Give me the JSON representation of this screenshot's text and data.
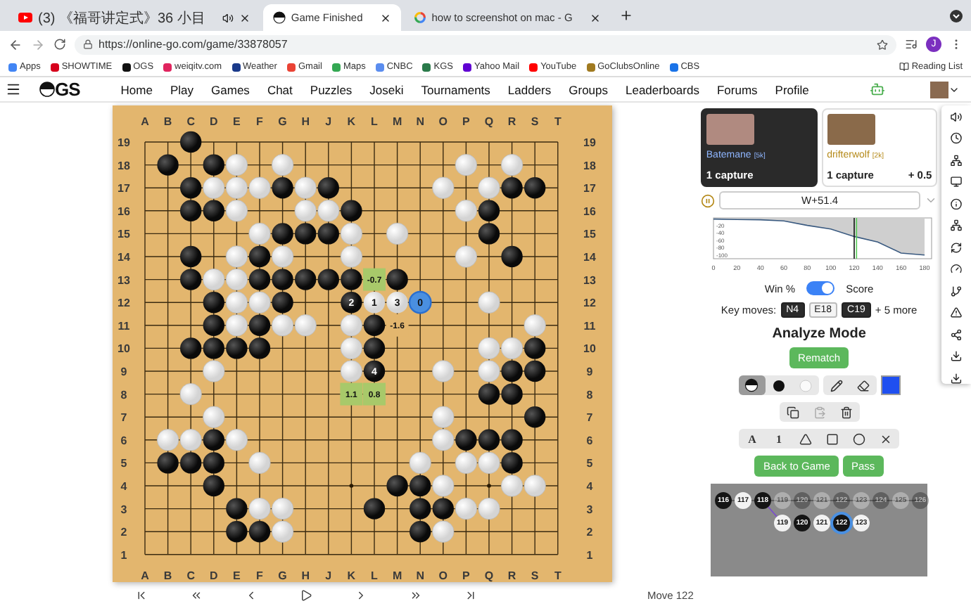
{
  "browser": {
    "tabs": [
      {
        "kind": "youtube",
        "title": "(3) 《福哥讲定式》36 小目",
        "audio": true,
        "selected": false
      },
      {
        "kind": "ogs",
        "title": "Game Finished",
        "audio": false,
        "selected": true
      },
      {
        "kind": "google",
        "title": "how to screenshot on mac - G",
        "audio": false,
        "selected": false
      }
    ],
    "url": "https://online-go.com/game/33878057",
    "profile": "J",
    "bookmarks": [
      {
        "label": "Apps",
        "color": "#4285f4"
      },
      {
        "label": "SHOWTIME",
        "color": "#d6001c"
      },
      {
        "label": "OGS",
        "color": "#111111"
      },
      {
        "label": "weiqitv.com",
        "color": "#e0245e"
      },
      {
        "label": "Weather",
        "color": "#1a3a8a"
      },
      {
        "label": "Gmail",
        "color": "#ea4335"
      },
      {
        "label": "Maps",
        "color": "#34a853"
      },
      {
        "label": "CNBC",
        "color": "#5b8def"
      },
      {
        "label": "KGS",
        "color": "#2a7a4a"
      },
      {
        "label": "Yahoo Mail",
        "color": "#6001d2"
      },
      {
        "label": "YouTube",
        "color": "#ff0000"
      },
      {
        "label": "GoClubsOnline",
        "color": "#a07a20"
      },
      {
        "label": "CBS",
        "color": "#1a73e8"
      }
    ],
    "reading_list": "Reading List"
  },
  "site_nav": {
    "logo": "GS",
    "links": [
      "Home",
      "Play",
      "Games",
      "Chat",
      "Puzzles",
      "Joseki",
      "Tournaments",
      "Ladders",
      "Groups",
      "Leaderboards",
      "Forums",
      "Profile"
    ]
  },
  "board": {
    "top_labels": [
      "A",
      "B",
      "C",
      "D",
      "E",
      "F",
      "G",
      "H",
      "J",
      "K",
      "L",
      "M",
      "N",
      "O",
      "P",
      "Q",
      "R",
      "S",
      "T"
    ],
    "bottom_labels": [
      "A",
      "B",
      "C",
      "D",
      "E",
      "F",
      "G",
      "H",
      "J",
      "K",
      "L",
      "M",
      "N",
      "O",
      "P",
      "Q",
      "R",
      "S",
      "T"
    ],
    "left_labels": [
      "19",
      "18",
      "17",
      "16",
      "15",
      "14",
      "13",
      "12",
      "11",
      "10",
      "9",
      "8",
      "7",
      "6",
      "5",
      "4",
      "3",
      "2",
      "1"
    ],
    "right_labels": [
      "19",
      "18",
      "17",
      "16",
      "15",
      "14",
      "13",
      "12",
      "11",
      "10",
      "9",
      "8",
      "7",
      "6",
      "5",
      "4",
      "3",
      "2",
      "1"
    ],
    "rows": [
      [
        {
          "kind": "empty"
        },
        {
          "kind": "empty"
        },
        {
          "kind": "black-stone"
        },
        {
          "kind": "empty"
        },
        {
          "kind": "empty"
        },
        {
          "kind": "empty"
        },
        {
          "kind": "empty"
        },
        {
          "kind": "empty"
        },
        {
          "kind": "empty"
        },
        {
          "kind": "empty"
        },
        {
          "kind": "empty"
        },
        {
          "kind": "empty"
        },
        {
          "kind": "empty"
        },
        {
          "kind": "empty"
        },
        {
          "kind": "empty"
        },
        {
          "kind": "empty"
        },
        {
          "kind": "empty"
        },
        {
          "kind": "empty"
        },
        {
          "kind": "empty"
        }
      ],
      [
        {
          "kind": "empty"
        },
        {
          "kind": "black-stone"
        },
        {
          "kind": "empty"
        },
        {
          "kind": "black-stone"
        },
        {
          "kind": "white-stone"
        },
        {
          "kind": "empty"
        },
        {
          "kind": "white-stone"
        },
        {
          "kind": "empty"
        },
        {
          "kind": "empty"
        },
        {
          "kind": "empty"
        },
        {
          "kind": "empty"
        },
        {
          "kind": "empty"
        },
        {
          "kind": "empty"
        },
        {
          "kind": "empty"
        },
        {
          "kind": "white-stone"
        },
        {
          "kind": "empty"
        },
        {
          "kind": "white-stone"
        },
        {
          "kind": "empty"
        },
        {
          "kind": "empty"
        }
      ],
      [
        {
          "kind": "empty"
        },
        {
          "kind": "empty"
        },
        {
          "kind": "black-stone"
        },
        {
          "kind": "white-stone"
        },
        {
          "kind": "white-stone"
        },
        {
          "kind": "white-stone"
        },
        {
          "kind": "black-stone"
        },
        {
          "kind": "white-stone"
        },
        {
          "kind": "black-stone"
        },
        {
          "kind": "empty"
        },
        {
          "kind": "empty"
        },
        {
          "kind": "empty"
        },
        {
          "kind": "empty"
        },
        {
          "kind": "white-stone"
        },
        {
          "kind": "empty"
        },
        {
          "kind": "white-stone"
        },
        {
          "kind": "black-stone"
        },
        {
          "kind": "black-stone"
        },
        {
          "kind": "empty"
        }
      ],
      [
        {
          "kind": "empty"
        },
        {
          "kind": "empty"
        },
        {
          "kind": "black-stone"
        },
        {
          "kind": "black-stone"
        },
        {
          "kind": "white-stone"
        },
        {
          "kind": "empty"
        },
        {
          "kind": "empty"
        },
        {
          "kind": "white-stone"
        },
        {
          "kind": "white-stone"
        },
        {
          "kind": "black-stone"
        },
        {
          "kind": "empty"
        },
        {
          "kind": "empty"
        },
        {
          "kind": "empty"
        },
        {
          "kind": "empty"
        },
        {
          "kind": "white-stone"
        },
        {
          "kind": "black-stone"
        },
        {
          "kind": "empty"
        },
        {
          "kind": "empty"
        },
        {
          "kind": "empty"
        }
      ],
      [
        {
          "kind": "empty"
        },
        {
          "kind": "empty"
        },
        {
          "kind": "empty"
        },
        {
          "kind": "empty"
        },
        {
          "kind": "empty"
        },
        {
          "kind": "white-stone"
        },
        {
          "kind": "black-stone"
        },
        {
          "kind": "black-stone"
        },
        {
          "kind": "black-stone"
        },
        {
          "kind": "white-stone"
        },
        {
          "kind": "empty"
        },
        {
          "kind": "white-stone"
        },
        {
          "kind": "empty"
        },
        {
          "kind": "empty"
        },
        {
          "kind": "empty"
        },
        {
          "kind": "black-stone"
        },
        {
          "kind": "empty"
        },
        {
          "kind": "empty"
        },
        {
          "kind": "empty"
        }
      ],
      [
        {
          "kind": "empty"
        },
        {
          "kind": "empty"
        },
        {
          "kind": "black-stone"
        },
        {
          "kind": "empty"
        },
        {
          "kind": "white-stone"
        },
        {
          "kind": "black-stone"
        },
        {
          "kind": "white-stone"
        },
        {
          "kind": "empty"
        },
        {
          "kind": "empty"
        },
        {
          "kind": "white-stone"
        },
        {
          "kind": "empty"
        },
        {
          "kind": "empty"
        },
        {
          "kind": "empty"
        },
        {
          "kind": "empty"
        },
        {
          "kind": "white-stone"
        },
        {
          "kind": "empty"
        },
        {
          "kind": "black-stone"
        },
        {
          "kind": "empty"
        },
        {
          "kind": "empty"
        }
      ],
      [
        {
          "kind": "empty"
        },
        {
          "kind": "empty"
        },
        {
          "kind": "black-stone"
        },
        {
          "kind": "white-stone"
        },
        {
          "kind": "white-stone"
        },
        {
          "kind": "black-stone"
        },
        {
          "kind": "black-stone"
        },
        {
          "kind": "black-stone"
        },
        {
          "kind": "black-stone"
        },
        {
          "kind": "black-stone"
        },
        {
          "kind": "score",
          "text": "-0.7",
          "highlighted": true
        },
        {
          "kind": "black-stone"
        },
        {
          "kind": "empty"
        },
        {
          "kind": "empty"
        },
        {
          "kind": "empty"
        },
        {
          "kind": "empty"
        },
        {
          "kind": "empty"
        },
        {
          "kind": "empty"
        },
        {
          "kind": "empty"
        }
      ],
      [
        {
          "kind": "empty"
        },
        {
          "kind": "empty"
        },
        {
          "kind": "empty"
        },
        {
          "kind": "black-stone"
        },
        {
          "kind": "white-stone"
        },
        {
          "kind": "white-stone"
        },
        {
          "kind": "black-stone"
        },
        {
          "kind": "empty"
        },
        {
          "kind": "empty"
        },
        {
          "kind": "numbered",
          "black": true,
          "candidate": false,
          "text": "2"
        },
        {
          "kind": "numbered",
          "black": false,
          "candidate": false,
          "text": "1"
        },
        {
          "kind": "numbered",
          "black": false,
          "candidate": false,
          "text": "3"
        },
        {
          "kind": "numbered",
          "black": false,
          "candidate": true,
          "text": "0"
        },
        {
          "kind": "empty"
        },
        {
          "kind": "empty"
        },
        {
          "kind": "white-stone"
        },
        {
          "kind": "empty"
        },
        {
          "kind": "empty"
        },
        {
          "kind": "empty"
        }
      ],
      [
        {
          "kind": "empty"
        },
        {
          "kind": "empty"
        },
        {
          "kind": "empty"
        },
        {
          "kind": "black-stone"
        },
        {
          "kind": "white-stone"
        },
        {
          "kind": "black-stone"
        },
        {
          "kind": "white-stone"
        },
        {
          "kind": "white-stone"
        },
        {
          "kind": "empty"
        },
        {
          "kind": "white-stone"
        },
        {
          "kind": "black-stone"
        },
        {
          "kind": "score",
          "text": "-1.6",
          "highlighted": false
        },
        {
          "kind": "empty"
        },
        {
          "kind": "empty"
        },
        {
          "kind": "empty"
        },
        {
          "kind": "empty"
        },
        {
          "kind": "empty"
        },
        {
          "kind": "white-stone"
        },
        {
          "kind": "empty"
        }
      ],
      [
        {
          "kind": "empty"
        },
        {
          "kind": "empty"
        },
        {
          "kind": "black-stone"
        },
        {
          "kind": "black-stone"
        },
        {
          "kind": "black-stone"
        },
        {
          "kind": "black-stone"
        },
        {
          "kind": "empty"
        },
        {
          "kind": "empty"
        },
        {
          "kind": "empty"
        },
        {
          "kind": "white-stone"
        },
        {
          "kind": "black-stone"
        },
        {
          "kind": "empty"
        },
        {
          "kind": "empty"
        },
        {
          "kind": "empty"
        },
        {
          "kind": "empty"
        },
        {
          "kind": "white-stone"
        },
        {
          "kind": "white-stone"
        },
        {
          "kind": "black-stone"
        },
        {
          "kind": "empty"
        }
      ],
      [
        {
          "kind": "empty"
        },
        {
          "kind": "empty"
        },
        {
          "kind": "empty"
        },
        {
          "kind": "white-stone"
        },
        {
          "kind": "empty"
        },
        {
          "kind": "empty"
        },
        {
          "kind": "empty"
        },
        {
          "kind": "empty"
        },
        {
          "kind": "empty"
        },
        {
          "kind": "white-stone"
        },
        {
          "kind": "numbered",
          "black": true,
          "candidate": false,
          "text": "4"
        },
        {
          "kind": "empty"
        },
        {
          "kind": "empty"
        },
        {
          "kind": "white-stone"
        },
        {
          "kind": "empty"
        },
        {
          "kind": "white-stone"
        },
        {
          "kind": "black-stone"
        },
        {
          "kind": "black-stone"
        },
        {
          "kind": "empty"
        }
      ],
      [
        {
          "kind": "empty"
        },
        {
          "kind": "empty"
        },
        {
          "kind": "white-stone"
        },
        {
          "kind": "empty"
        },
        {
          "kind": "empty"
        },
        {
          "kind": "empty"
        },
        {
          "kind": "empty"
        },
        {
          "kind": "empty"
        },
        {
          "kind": "empty"
        },
        {
          "kind": "score",
          "text": "1.1",
          "highlighted": true
        },
        {
          "kind": "score",
          "text": "0.8",
          "highlighted": true
        },
        {
          "kind": "empty"
        },
        {
          "kind": "empty"
        },
        {
          "kind": "empty"
        },
        {
          "kind": "empty"
        },
        {
          "kind": "black-stone"
        },
        {
          "kind": "black-stone"
        },
        {
          "kind": "empty"
        },
        {
          "kind": "empty"
        }
      ],
      [
        {
          "kind": "empty"
        },
        {
          "kind": "empty"
        },
        {
          "kind": "empty"
        },
        {
          "kind": "white-stone"
        },
        {
          "kind": "empty"
        },
        {
          "kind": "empty"
        },
        {
          "kind": "empty"
        },
        {
          "kind": "empty"
        },
        {
          "kind": "empty"
        },
        {
          "kind": "empty"
        },
        {
          "kind": "empty"
        },
        {
          "kind": "empty"
        },
        {
          "kind": "empty"
        },
        {
          "kind": "white-stone"
        },
        {
          "kind": "empty"
        },
        {
          "kind": "empty"
        },
        {
          "kind": "empty"
        },
        {
          "kind": "black-stone"
        },
        {
          "kind": "empty"
        }
      ],
      [
        {
          "kind": "empty"
        },
        {
          "kind": "white-stone"
        },
        {
          "kind": "white-stone"
        },
        {
          "kind": "black-stone"
        },
        {
          "kind": "white-stone"
        },
        {
          "kind": "empty"
        },
        {
          "kind": "empty"
        },
        {
          "kind": "empty"
        },
        {
          "kind": "empty"
        },
        {
          "kind": "empty"
        },
        {
          "kind": "empty"
        },
        {
          "kind": "empty"
        },
        {
          "kind": "empty"
        },
        {
          "kind": "white-stone"
        },
        {
          "kind": "black-stone"
        },
        {
          "kind": "black-stone"
        },
        {
          "kind": "black-stone"
        },
        {
          "kind": "empty"
        },
        {
          "kind": "empty"
        }
      ],
      [
        {
          "kind": "empty"
        },
        {
          "kind": "black-stone"
        },
        {
          "kind": "black-stone"
        },
        {
          "kind": "black-stone"
        },
        {
          "kind": "empty"
        },
        {
          "kind": "white-stone"
        },
        {
          "kind": "empty"
        },
        {
          "kind": "empty"
        },
        {
          "kind": "empty"
        },
        {
          "kind": "empty"
        },
        {
          "kind": "empty"
        },
        {
          "kind": "empty"
        },
        {
          "kind": "white-stone"
        },
        {
          "kind": "empty"
        },
        {
          "kind": "white-stone"
        },
        {
          "kind": "white-stone"
        },
        {
          "kind": "black-stone"
        },
        {
          "kind": "empty"
        },
        {
          "kind": "empty"
        }
      ],
      [
        {
          "kind": "empty"
        },
        {
          "kind": "empty"
        },
        {
          "kind": "empty"
        },
        {
          "kind": "black-stone"
        },
        {
          "kind": "empty"
        },
        {
          "kind": "empty"
        },
        {
          "kind": "empty"
        },
        {
          "kind": "empty"
        },
        {
          "kind": "empty"
        },
        {
          "kind": "empty"
        },
        {
          "kind": "empty"
        },
        {
          "kind": "black-stone"
        },
        {
          "kind": "black-stone"
        },
        {
          "kind": "white-stone"
        },
        {
          "kind": "empty"
        },
        {
          "kind": "empty"
        },
        {
          "kind": "white-stone"
        },
        {
          "kind": "white-stone"
        },
        {
          "kind": "empty"
        }
      ],
      [
        {
          "kind": "empty"
        },
        {
          "kind": "empty"
        },
        {
          "kind": "empty"
        },
        {
          "kind": "empty"
        },
        {
          "kind": "black-stone"
        },
        {
          "kind": "white-stone"
        },
        {
          "kind": "white-stone"
        },
        {
          "kind": "empty"
        },
        {
          "kind": "empty"
        },
        {
          "kind": "empty"
        },
        {
          "kind": "black-stone"
        },
        {
          "kind": "empty"
        },
        {
          "kind": "black-stone"
        },
        {
          "kind": "black-stone"
        },
        {
          "kind": "white-stone"
        },
        {
          "kind": "white-stone"
        },
        {
          "kind": "empty"
        },
        {
          "kind": "empty"
        },
        {
          "kind": "empty"
        }
      ],
      [
        {
          "kind": "empty"
        },
        {
          "kind": "empty"
        },
        {
          "kind": "empty"
        },
        {
          "kind": "empty"
        },
        {
          "kind": "black-stone"
        },
        {
          "kind": "black-stone"
        },
        {
          "kind": "white-stone"
        },
        {
          "kind": "empty"
        },
        {
          "kind": "empty"
        },
        {
          "kind": "empty"
        },
        {
          "kind": "empty"
        },
        {
          "kind": "empty"
        },
        {
          "kind": "black-stone"
        },
        {
          "kind": "white-stone"
        },
        {
          "kind": "empty"
        },
        {
          "kind": "empty"
        },
        {
          "kind": "empty"
        },
        {
          "kind": "empty"
        },
        {
          "kind": "empty"
        }
      ],
      [
        {
          "kind": "empty"
        },
        {
          "kind": "empty"
        },
        {
          "kind": "empty"
        },
        {
          "kind": "empty"
        },
        {
          "kind": "empty"
        },
        {
          "kind": "empty"
        },
        {
          "kind": "empty"
        },
        {
          "kind": "empty"
        },
        {
          "kind": "empty"
        },
        {
          "kind": "empty"
        },
        {
          "kind": "empty"
        },
        {
          "kind": "empty"
        },
        {
          "kind": "empty"
        },
        {
          "kind": "empty"
        },
        {
          "kind": "empty"
        },
        {
          "kind": "empty"
        },
        {
          "kind": "empty"
        },
        {
          "kind": "empty"
        },
        {
          "kind": "empty"
        }
      ]
    ]
  },
  "move_label": "Move 122",
  "players": [
    {
      "name": "Batemane",
      "rank": "[5k]",
      "captures": "1 capture",
      "selected": true
    },
    {
      "name": "drifterwolf",
      "rank": "[2k]",
      "captures": "1 capture",
      "bonus": "+ 0.5",
      "selected": false
    }
  ],
  "score": "W+51.4",
  "graph": {
    "chart_data": {
      "type": "area",
      "x": [
        0,
        20,
        40,
        60,
        80,
        100,
        120,
        140,
        160,
        180
      ],
      "series": [
        {
          "color": "#3a5a80",
          "values": [
            -3,
            -4,
            -5,
            -8,
            -20,
            -30,
            -50,
            -65,
            -95,
            -100
          ]
        }
      ],
      "xlim": [
        0,
        186
      ],
      "ylim": [
        -110,
        0
      ],
      "xticks": [
        0,
        20,
        40,
        60,
        80,
        100,
        120,
        140,
        160,
        180
      ],
      "yticks": [
        -20,
        -40,
        -60,
        -80,
        -100
      ]
    }
  },
  "toggle": {
    "left": "Win %",
    "right": "Score",
    "on": true
  },
  "key_moves": {
    "label": "Key moves:",
    "moves": [
      {
        "text": "N4",
        "dark": true
      },
      {
        "text": "E18",
        "dark": false
      },
      {
        "text": "C19",
        "dark": true
      }
    ],
    "more": "+ 5 more"
  },
  "mode_title": "Analyze Mode",
  "rematch": "Rematch",
  "tool_rows": [
    [
      [
        {
          "kind": "half-stone",
          "selected": true
        },
        {
          "kind": "black-stone",
          "selected": false
        },
        {
          "kind": "white-stone",
          "selected": false
        }
      ],
      [
        {
          "kind": "pencil",
          "selected": false
        },
        {
          "kind": "eraser",
          "selected": false
        }
      ]
    ],
    [
      [
        {
          "kind": "copy",
          "selected": false
        },
        {
          "kind": "paste",
          "selected": false
        },
        {
          "kind": "delete",
          "selected": false
        }
      ]
    ],
    [
      [
        {
          "kind": "letter",
          "text": "A",
          "selected": false
        },
        {
          "kind": "number",
          "text": "1",
          "selected": false
        },
        {
          "kind": "triangle",
          "selected": false
        },
        {
          "kind": "square",
          "selected": false
        },
        {
          "kind": "circle",
          "selected": false
        },
        {
          "kind": "cross",
          "selected": false
        }
      ]
    ]
  ],
  "pen": {
    "color": "#1f4ff0"
  },
  "actions": [
    "Back to Game",
    "Pass"
  ],
  "move_tree": {
    "main": [
      {
        "text": "116",
        "black": true,
        "faded": false
      },
      {
        "text": "117",
        "black": false,
        "faded": false
      },
      {
        "text": "118",
        "black": true,
        "faded": false
      },
      {
        "text": "119",
        "black": false,
        "faded": true
      },
      {
        "text": "120",
        "black": true,
        "faded": true
      },
      {
        "text": "121",
        "black": false,
        "faded": true
      },
      {
        "text": "122",
        "black": true,
        "faded": true
      },
      {
        "text": "123",
        "black": false,
        "faded": true
      },
      {
        "text": "124",
        "black": true,
        "faded": true
      },
      {
        "text": "125",
        "black": false,
        "faded": true
      },
      {
        "text": "126",
        "black": true,
        "faded": true
      }
    ],
    "branch": [
      {
        "text": "119",
        "black": false,
        "selected": false
      },
      {
        "text": "120",
        "black": true,
        "selected": false
      },
      {
        "text": "121",
        "black": false,
        "selected": false
      },
      {
        "text": "122",
        "black": true,
        "selected": true
      },
      {
        "text": "123",
        "black": false,
        "selected": false
      }
    ]
  }
}
